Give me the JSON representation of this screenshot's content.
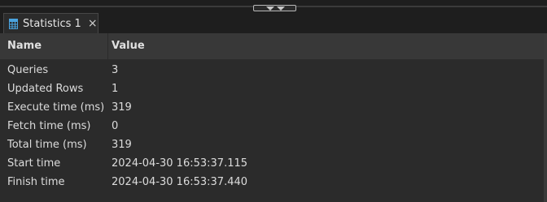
{
  "tab": {
    "icon": "grid-table-icon",
    "label": "Statistics 1",
    "close_glyph": "×"
  },
  "table": {
    "columns": [
      "Name",
      "Value"
    ],
    "rows": [
      {
        "name": "Queries",
        "value": "3"
      },
      {
        "name": "Updated Rows",
        "value": "1"
      },
      {
        "name": "Execute time (ms)",
        "value": "319"
      },
      {
        "name": "Fetch time (ms)",
        "value": "0"
      },
      {
        "name": "Total time (ms)",
        "value": "319"
      },
      {
        "name": "Start time",
        "value": "2024-04-30 16:53:37.115"
      },
      {
        "name": "Finish time",
        "value": "2024-04-30 16:53:37.440"
      }
    ]
  },
  "colors": {
    "background": "#2b2b2b",
    "header": "#383838",
    "tab_icon": "#4aa3df"
  }
}
